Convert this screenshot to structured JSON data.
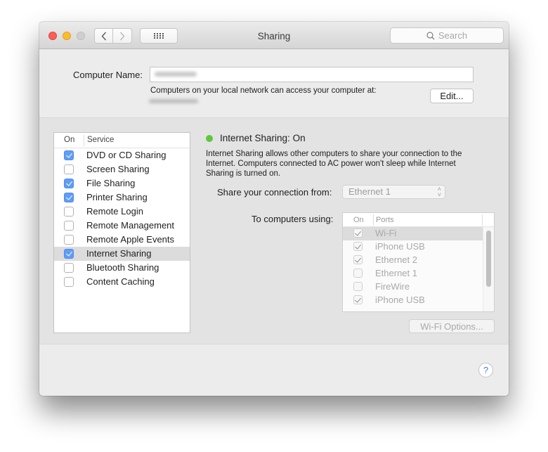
{
  "window": {
    "title": "Sharing",
    "search_placeholder": "Search",
    "traffic_lights": [
      "close",
      "minimize",
      "zoom"
    ]
  },
  "toolbar": {
    "back_icon": "chevron-left-icon",
    "forward_icon": "chevron-right-icon",
    "grid_icon": "show-all-grid-icon"
  },
  "computer_name": {
    "label": "Computer Name:",
    "value": "",
    "access_text": "Computers on your local network can access your computer at:",
    "edit_label": "Edit..."
  },
  "services": {
    "headers": {
      "on": "On",
      "service": "Service"
    },
    "items": [
      {
        "label": "DVD or CD Sharing",
        "on": true,
        "selected": false
      },
      {
        "label": "Screen Sharing",
        "on": false,
        "selected": false
      },
      {
        "label": "File Sharing",
        "on": true,
        "selected": false
      },
      {
        "label": "Printer Sharing",
        "on": true,
        "selected": false
      },
      {
        "label": "Remote Login",
        "on": false,
        "selected": false
      },
      {
        "label": "Remote Management",
        "on": false,
        "selected": false
      },
      {
        "label": "Remote Apple Events",
        "on": false,
        "selected": false
      },
      {
        "label": "Internet Sharing",
        "on": true,
        "selected": true
      },
      {
        "label": "Bluetooth Sharing",
        "on": false,
        "selected": false
      },
      {
        "label": "Content Caching",
        "on": false,
        "selected": false
      }
    ]
  },
  "detail": {
    "status": "Internet Sharing: On",
    "status_color": "#5dc83e",
    "description": "Internet Sharing allows other computers to share your connection to the Internet. Computers connected to AC power won't sleep while Internet Sharing is turned on.",
    "share_from_label": "Share your connection from:",
    "share_from_value": "Ethernet 1",
    "to_computers_label": "To computers using:",
    "ports_headers": {
      "on": "On",
      "ports": "Ports"
    },
    "ports": [
      {
        "label": "Wi-Fi",
        "on": true,
        "selected": true
      },
      {
        "label": "iPhone USB",
        "on": true,
        "selected": false
      },
      {
        "label": "Ethernet 2",
        "on": true,
        "selected": false
      },
      {
        "label": "Ethernet 1",
        "on": false,
        "selected": false
      },
      {
        "label": "FireWire",
        "on": false,
        "selected": false
      },
      {
        "label": "iPhone USB",
        "on": true,
        "selected": false
      }
    ],
    "wifi_options_label": "Wi-Fi Options..."
  },
  "footer": {
    "help_label": "?"
  }
}
